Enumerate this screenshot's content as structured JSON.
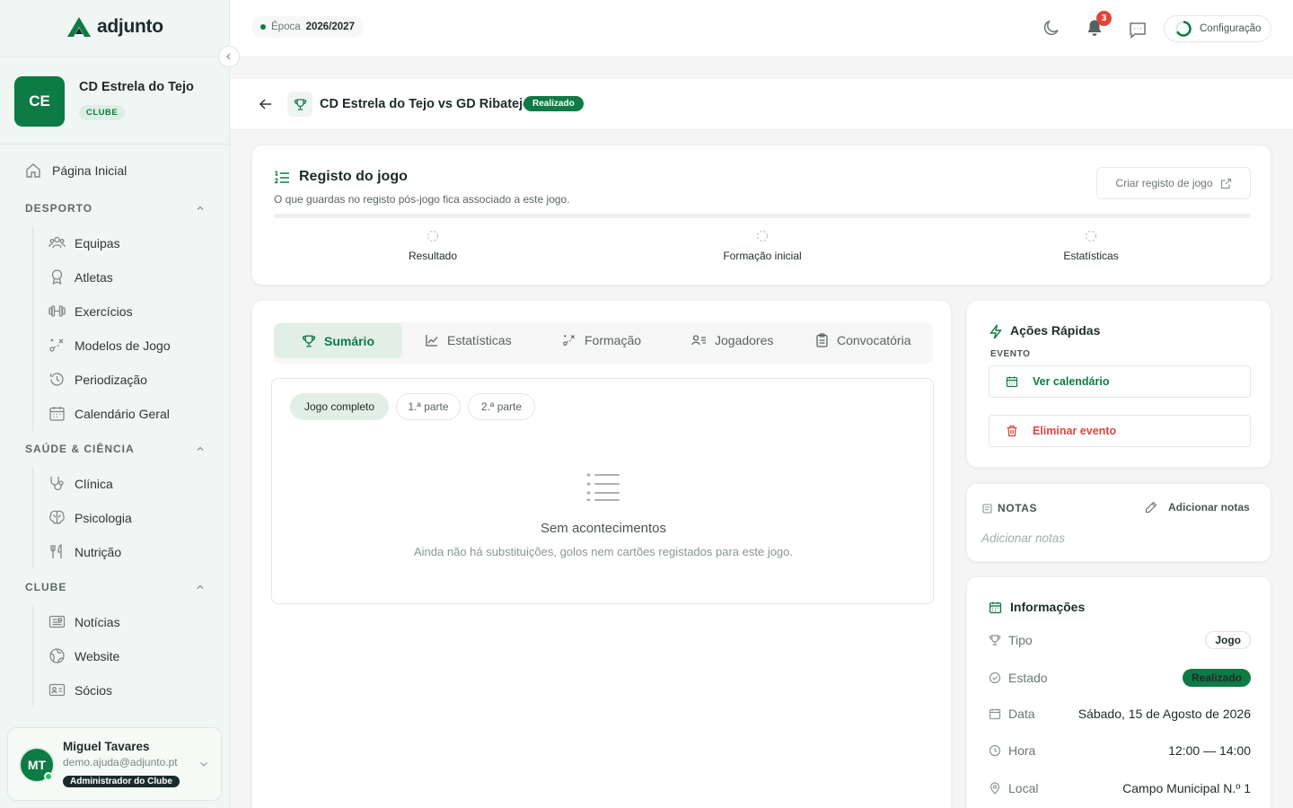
{
  "brand": {
    "name": "adjunto"
  },
  "club": {
    "initials": "CE",
    "name": "CD Estrela do Tejo",
    "badge": "CLUBE"
  },
  "sidebar": {
    "home": "Página Inicial",
    "sections": [
      {
        "title": "DESPORTO",
        "items": [
          "Equipas",
          "Atletas",
          "Exercícios",
          "Modelos de Jogo",
          "Periodização",
          "Calendário Geral"
        ]
      },
      {
        "title": "SAÚDE & CIÊNCIA",
        "items": [
          "Clínica",
          "Psicologia",
          "Nutrição"
        ]
      },
      {
        "title": "CLUBE",
        "items": [
          "Notícias",
          "Website",
          "Sócios"
        ]
      }
    ]
  },
  "user": {
    "initials": "MT",
    "name": "Miguel Tavares",
    "email": "demo.ajuda@adjunto.pt",
    "role": "Administrador do Clube"
  },
  "topbar": {
    "season_label": "Época",
    "season_value": "2026/2027",
    "notifications": "3",
    "config": "Configuração"
  },
  "header": {
    "title": "CD Estrela do Tejo vs GD Ribatejo",
    "status": "Realizado"
  },
  "registo": {
    "title": "Registo do jogo",
    "subtitle": "O que guardas no registo pós-jogo fica associado a este jogo.",
    "button": "Criar registo de jogo",
    "steps": [
      "Resultado",
      "Formação inicial",
      "Estatísticas"
    ]
  },
  "tabs": [
    "Sumário",
    "Estatísticas",
    "Formação",
    "Jogadores",
    "Convocatória"
  ],
  "filters": [
    "Jogo completo",
    "1.ª parte",
    "2.ª parte"
  ],
  "empty": {
    "title": "Sem acontecimentos",
    "description": "Ainda não há substituições, golos nem cartões registados para este jogo."
  },
  "acoes": {
    "title": "Ações Rápidas",
    "section": "EVENTO",
    "calendar": "Ver calendário",
    "delete": "Eliminar evento"
  },
  "notas": {
    "title": "NOTAS",
    "add": "Adicionar notas",
    "placeholder": "Adicionar notas"
  },
  "info": {
    "title": "Informações",
    "rows": {
      "tipo": {
        "label": "Tipo",
        "value": "Jogo"
      },
      "estado": {
        "label": "Estado",
        "value": "Realizado"
      },
      "data": {
        "label": "Data",
        "value": "Sábado, 15 de Agosto de 2026"
      },
      "hora": {
        "label": "Hora",
        "value": "12:00 — 14:00"
      },
      "local": {
        "label": "Local",
        "value": "Campo Municipal N.º 1"
      }
    }
  },
  "colors": {
    "accent": "#0e7a45",
    "danger": "#e0453c",
    "sidebar_bg": "#f0f6f3"
  }
}
